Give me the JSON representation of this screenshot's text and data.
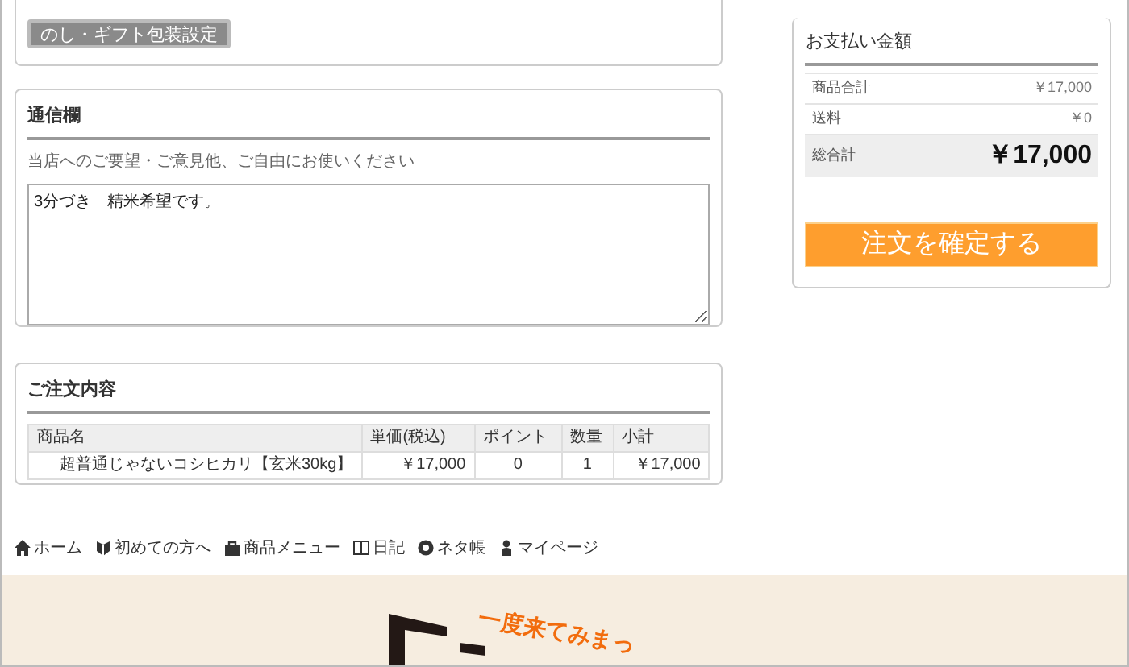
{
  "gift_button": {
    "label": "のし・ギフト包装設定"
  },
  "message": {
    "title": "通信欄",
    "hint": "当店へのご要望・ご意見他、ご自由にお使いください",
    "value": "3分づき　精米希望です。"
  },
  "order": {
    "title": "ご注文内容",
    "columns": [
      "商品名",
      "単価(税込)",
      "ポイント",
      "数量",
      "小計"
    ],
    "rows": [
      [
        "超普通じゃないコシヒカリ【玄米30kg】",
        "￥17,000",
        "0",
        "1",
        "￥17,000"
      ]
    ]
  },
  "payment": {
    "title": "お支払い金額",
    "rows": [
      {
        "kind": "normal",
        "label": "商品合計",
        "value": "￥17,000"
      },
      {
        "kind": "normal",
        "label": "送料",
        "value": "￥0"
      },
      {
        "kind": "total",
        "label": "総合計",
        "value": "￥17,000"
      }
    ],
    "confirm_button": "注文を確定する"
  },
  "footer_nav": [
    {
      "kind": "home",
      "label": "ホーム"
    },
    {
      "kind": "beginner",
      "label": "初めての方へ"
    },
    {
      "kind": "shop",
      "label": "商品メニュー"
    },
    {
      "kind": "book",
      "label": "日記"
    },
    {
      "kind": "memo",
      "label": "ネタ帳"
    },
    {
      "kind": "person",
      "label": "マイページ"
    }
  ],
  "banner": {
    "tagline": "一度来てみまっ"
  }
}
